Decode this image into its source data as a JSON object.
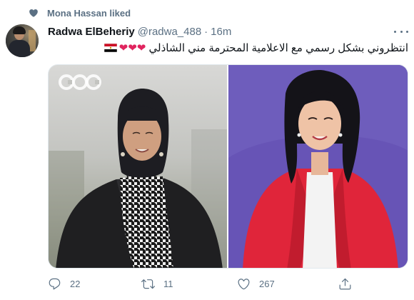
{
  "context": {
    "text": "Mona Hassan liked",
    "icon": "heart-icon"
  },
  "tweet": {
    "author_name": "Radwa ElBeheriy",
    "handle": "@radwa_488",
    "separator": "·",
    "time": "16m",
    "text": "انتظروني بشكل رسمي مع الاعلامية المحترمة مني الشاذلي",
    "emoji_hearts": "❤❤❤",
    "emoji_flag": "egypt-flag-emoji"
  },
  "media": {
    "left_photo": {
      "logo_text": "CBC"
    },
    "right_photo": {}
  },
  "actions": {
    "reply_count": "22",
    "retweet_count": "11",
    "like_count": "267"
  },
  "colors": {
    "secondary_text": "#5b7083",
    "heart_red": "#e0245e",
    "right_photo_bg": "#6552b5",
    "jacket_red": "#e0253a"
  }
}
